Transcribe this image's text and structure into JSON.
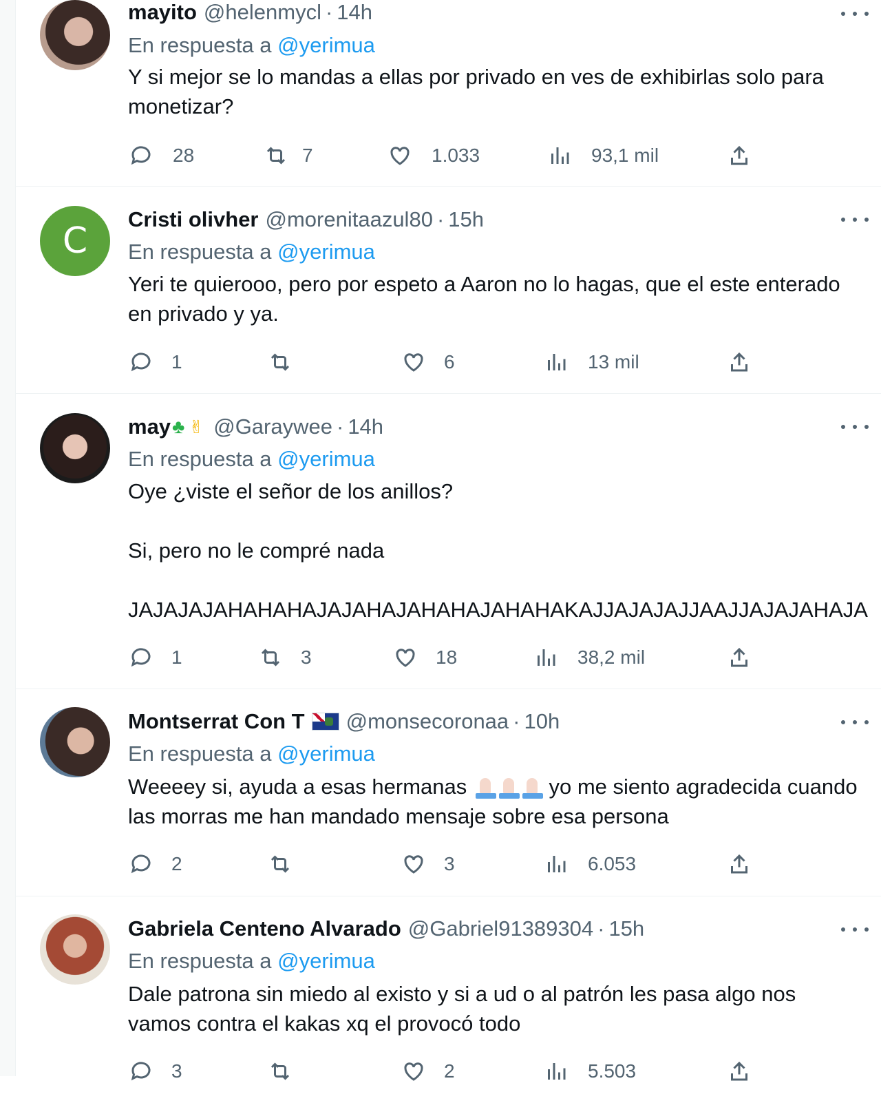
{
  "reply_prefix": "En respuesta a",
  "tweets": [
    {
      "name": "mayito",
      "handle": "@helenmycl",
      "time": "14h",
      "reply_to": "@yerimua",
      "text": "Y si mejor se lo mandas a ellas por privado en ves de exhibirlas solo para monetizar?",
      "replies": "28",
      "retweets": "7",
      "likes": "1.033",
      "views": "93,1 mil"
    },
    {
      "name": "Cristi olivher",
      "handle": "@morenitaazul80",
      "time": "15h",
      "avatar_letter": "C",
      "avatar_color": "#5ba33b",
      "reply_to": "@yerimua",
      "text": "Yeri te quierooo, pero por espeto a Aaron no lo hagas, que el este enterado en privado y ya.",
      "replies": "1",
      "retweets": "",
      "likes": "6",
      "views": "13 mil"
    },
    {
      "name": "may",
      "handle": "@Garaywee",
      "time": "14h",
      "reply_to": "@yerimua",
      "text": "Oye ¿viste el señor de los anillos?\n\nSi, pero no le compré nada\n\nJAJAJAJAHAHAHAJAJAHAJAHAHAJAHAHAKAJJAJAJAJJAAJJAJAJAHAJA",
      "replies": "1",
      "retweets": "3",
      "likes": "18",
      "views": "38,2 mil"
    },
    {
      "name": "Montserrat Con T",
      "handle": "@monsecoronaa",
      "time": "10h",
      "reply_to": "@yerimua",
      "text_before": "Weeeey si, ayuda a esas hermanas",
      "text_after": " yo me siento agradecida cuando las morras me han mandado mensaje sobre esa persona",
      "replies": "2",
      "retweets": "",
      "likes": "3",
      "views": "6.053"
    },
    {
      "name": "Gabriela Centeno Alvarado",
      "handle": "@Gabriel91389304",
      "time": "15h",
      "reply_to": "@yerimua",
      "text": "Dale patrona sin miedo al existo y si a ud o al patrón les pasa algo nos vamos contra el kakas xq el provocó todo",
      "replies": "3",
      "retweets": "",
      "likes": "2",
      "views": "5.503"
    }
  ]
}
